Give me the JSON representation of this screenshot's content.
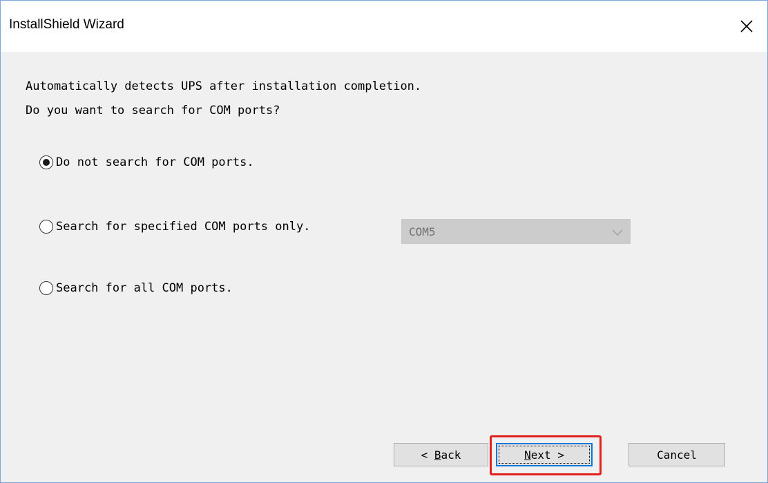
{
  "window": {
    "title": "InstallShield Wizard"
  },
  "message": {
    "line1": "Automatically detects UPS after installation completion.",
    "line2": "Do you want to search for COM ports?"
  },
  "options": [
    {
      "label": "Do not search for COM ports.",
      "selected": true
    },
    {
      "label": "Search for specified COM ports only.",
      "selected": false
    },
    {
      "label": "Search for all COM ports.",
      "selected": false
    }
  ],
  "com_port_select": {
    "value": "COM5",
    "enabled": false
  },
  "buttons": {
    "back": {
      "prefix": "< ",
      "mnemonic": "B",
      "rest": "ack"
    },
    "next": {
      "mnemonic": "N",
      "rest": "ext >"
    },
    "cancel": {
      "label": "Cancel"
    }
  },
  "colors": {
    "accent": "#0078d7",
    "highlight": "#e0201c",
    "dialog_background": "#f0f0f0"
  },
  "icons": {
    "close": "close-icon",
    "dropdown": "chevron-down-icon"
  }
}
